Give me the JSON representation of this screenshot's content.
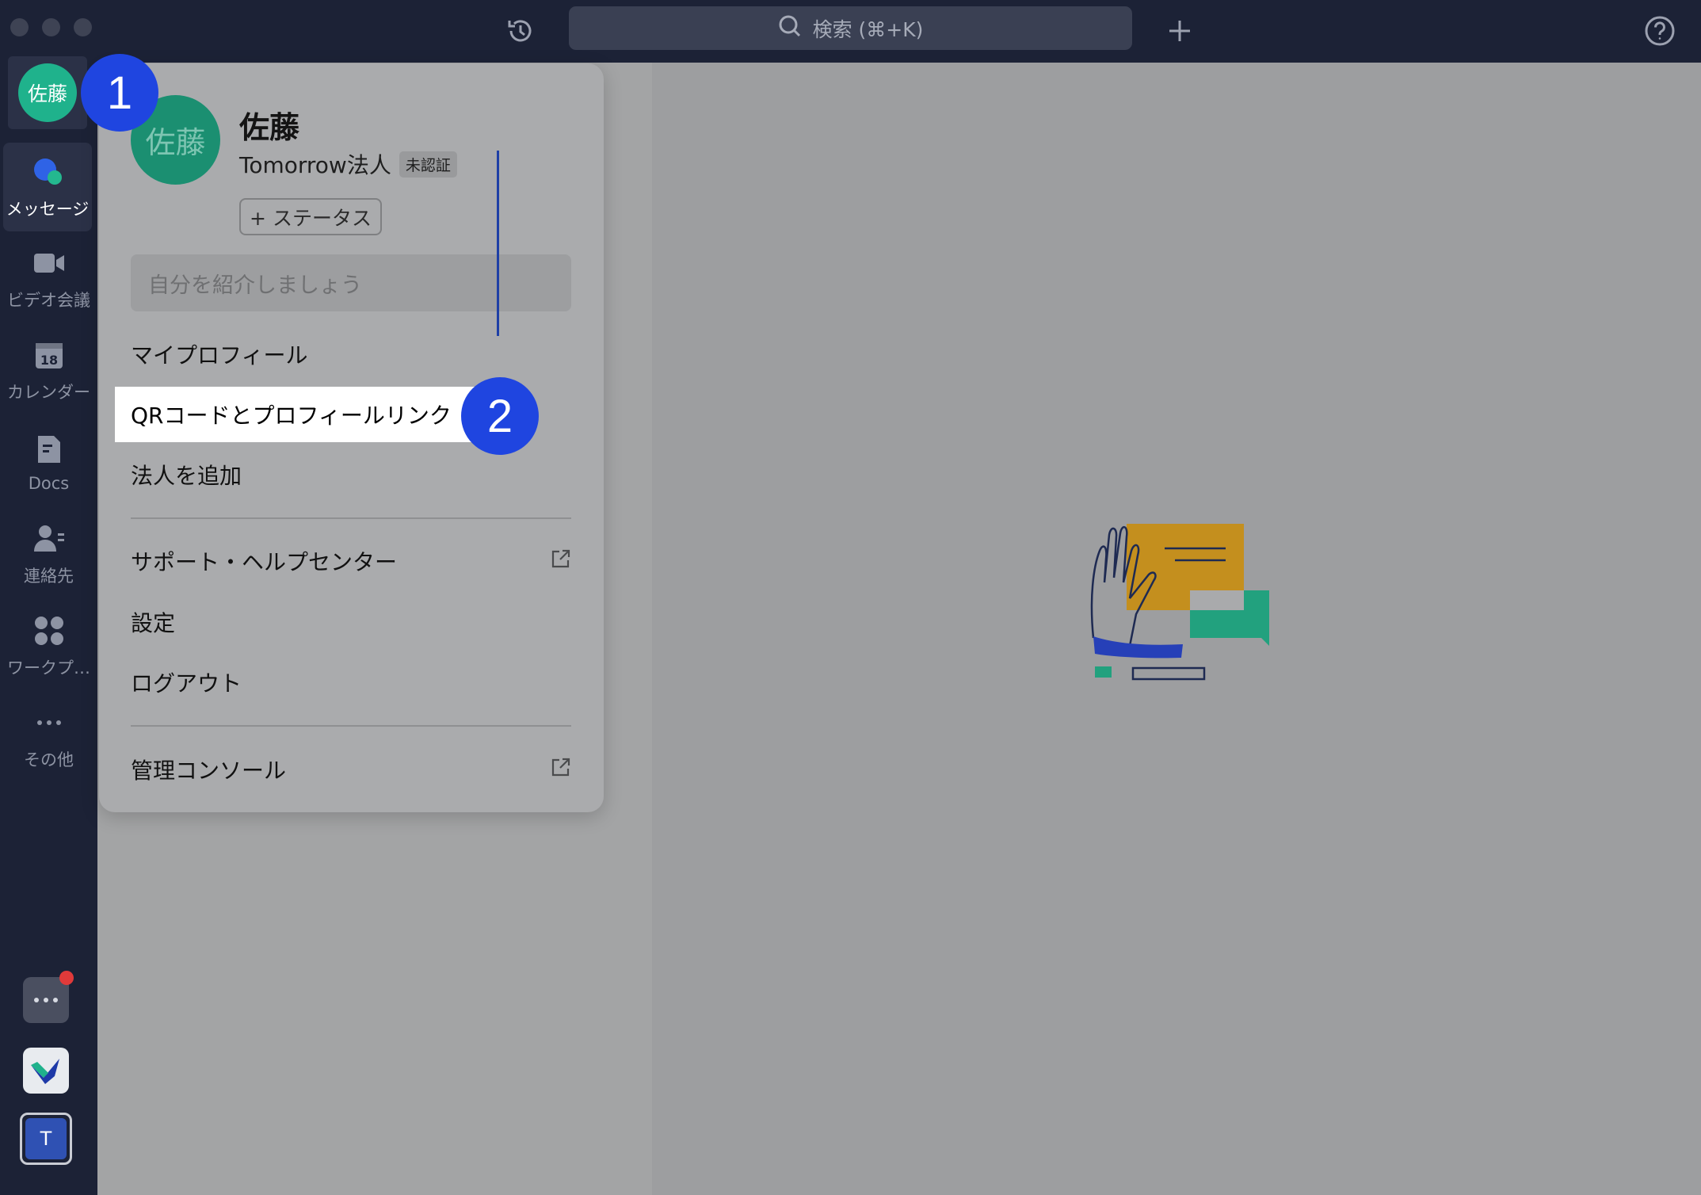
{
  "titlebar": {
    "history_icon": "history-icon",
    "search_placeholder": "検索 (⌘+K)",
    "add_icon": "plus-icon",
    "help_icon": "help-icon"
  },
  "profile": {
    "avatar_text": "佐藤",
    "name": "佐藤",
    "organization": "Tomorrow法人",
    "verification_badge": "未認証",
    "status_button": "+ ステータス",
    "intro_placeholder": "自分を紹介しましょう"
  },
  "menu": {
    "my_profile": "マイプロフィール",
    "qr_code": "QRコードとプロフィールリンク",
    "add_org": "法人を追加",
    "support": "サポート・ヘルプセンター",
    "settings": "設定",
    "logout": "ログアウト",
    "admin_console": "管理コンソール"
  },
  "nav": {
    "messages": "メッセージ",
    "video": "ビデオ会議",
    "calendar": "カレンダー",
    "calendar_day": "18",
    "docs": "Docs",
    "contacts": "連絡先",
    "workplace": "ワークプ…",
    "more": "その他"
  },
  "rail_bottom": {
    "org_initial": "T",
    "notification_dot_color": "#e03a3a"
  },
  "steps": {
    "step1": "1",
    "step2": "2"
  },
  "colors": {
    "accent_blue": "#1f45e0",
    "avatar_green": "#1fb28c",
    "sidebar": "#1c2236"
  }
}
